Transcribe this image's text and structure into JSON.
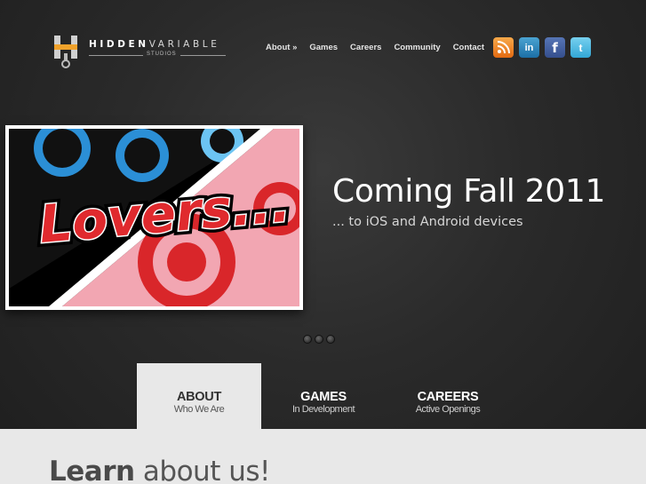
{
  "logo": {
    "word_bold": "HIDDEN",
    "word_light": "VARIABLE",
    "sub": "STUDIOS"
  },
  "nav": {
    "items": [
      "About »",
      "Games",
      "Careers",
      "Community",
      "Contact"
    ]
  },
  "social": {
    "rss": "rss-icon",
    "linkedin_label": "in",
    "facebook_label": "f",
    "twitter_label": "t"
  },
  "hero": {
    "art_text": "Lovers...",
    "title": "Coming Fall 2011",
    "subtitle": "... to iOS and Android devices"
  },
  "tabs": [
    {
      "title": "ABOUT",
      "sub": "Who We Are"
    },
    {
      "title": "GAMES",
      "sub": "In Development"
    },
    {
      "title": "CAREERS",
      "sub": "Active Openings"
    }
  ],
  "content": {
    "heading_bold": "Learn",
    "heading_rest": " about us!"
  },
  "colors": {
    "background": "#2a2a2a",
    "active_tab": "#e8e8e8",
    "art_red": "#d9262a"
  }
}
